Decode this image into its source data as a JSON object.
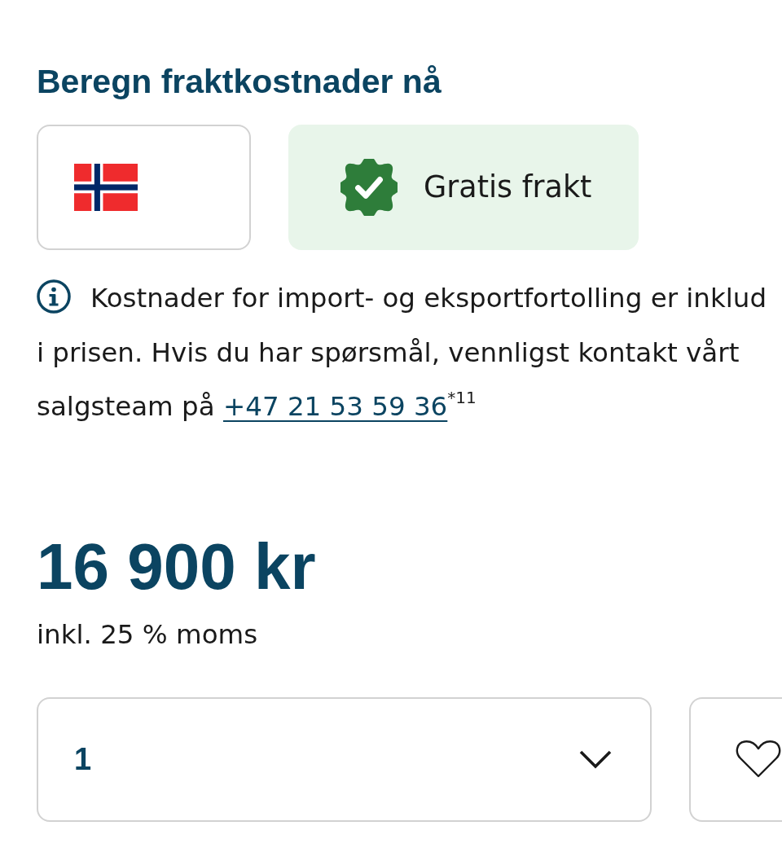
{
  "shipping": {
    "title": "Beregn fraktkostnader nå",
    "option": {
      "label": "Gratis frakt"
    }
  },
  "info": {
    "text": "Kostnader for import- og eksportfortolling er inklud i prisen. Hvis du har spørsmål, vennligst kontakt vårt salgsteam på",
    "phone_link": "+47 21 53 59 36",
    "footnote": "$^{*11}$"
  },
  "price": {
    "amount": "16 900 kr",
    "vat_note": "inkl. 25 % moms"
  },
  "quantity": {
    "value": "1"
  }
}
